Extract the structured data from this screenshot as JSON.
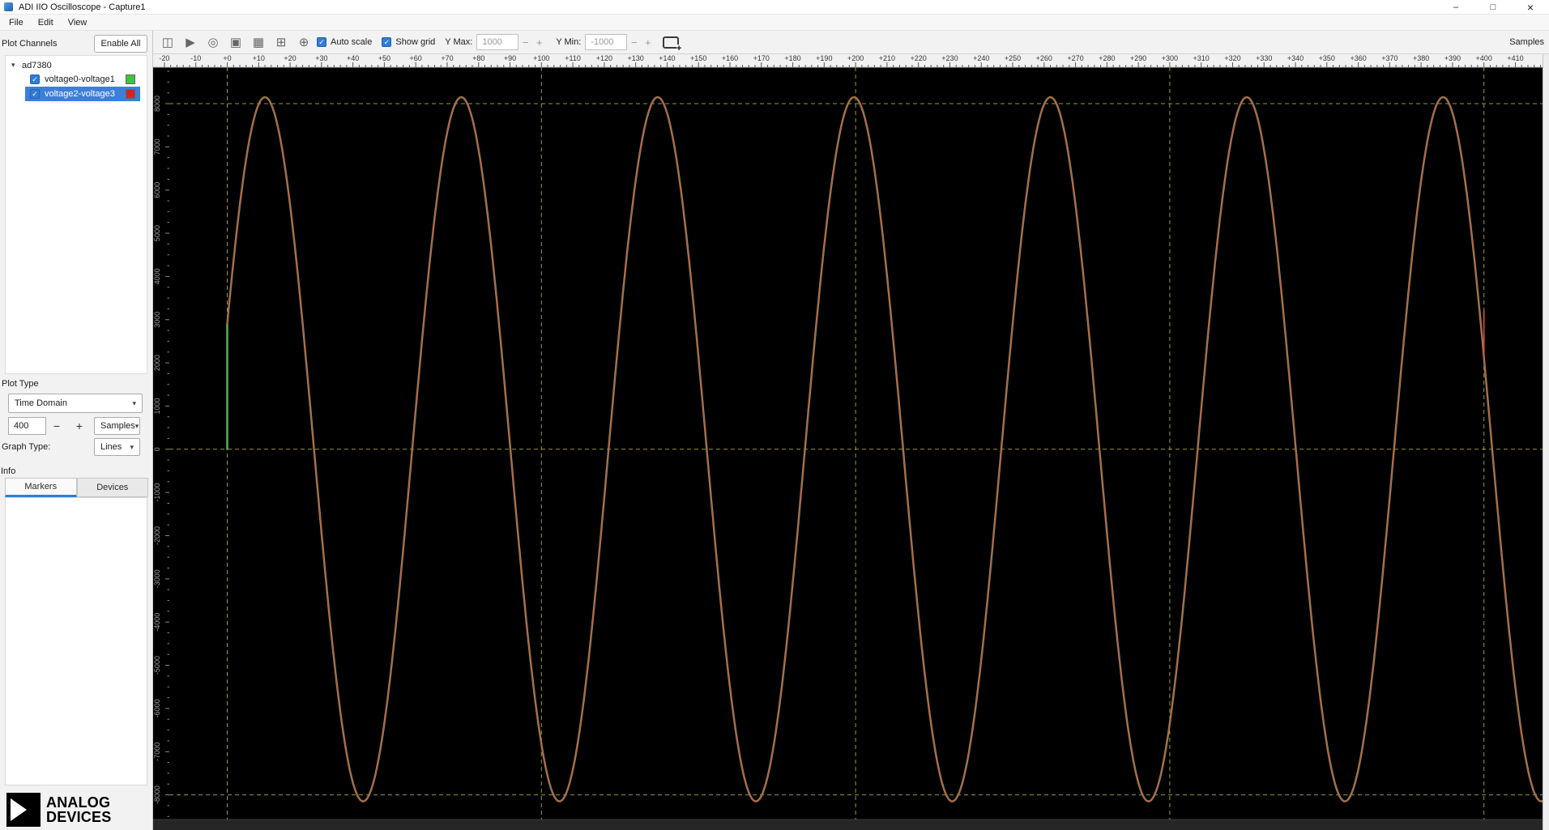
{
  "window": {
    "title": "ADI IIO Oscilloscope - Capture1",
    "controls": {
      "minimize": "–",
      "maximize": "□",
      "close": "×"
    }
  },
  "menu": {
    "items": [
      "File",
      "Edit",
      "View"
    ]
  },
  "toolbar": {
    "icons": [
      {
        "name": "capture-windows-icon",
        "glyph": "◫"
      },
      {
        "name": "play-icon",
        "glyph": "▶"
      },
      {
        "name": "capture-loop-icon",
        "glyph": "◎"
      },
      {
        "name": "snapshot-icon",
        "glyph": "▣"
      },
      {
        "name": "grid-view-icon",
        "glyph": "▦"
      },
      {
        "name": "add-grid-icon",
        "glyph": "⊞"
      },
      {
        "name": "pan-tool-icon",
        "glyph": "⊕"
      }
    ],
    "check_glyph": "✓",
    "autoscale_label": "Auto scale",
    "showgrid_label": "Show grid",
    "ymax_label": "Y Max:",
    "ymax_value": "1000",
    "ymin_label": "Y Min:",
    "ymin_value": "-1000",
    "minus_glyph": "−",
    "plus_glyph": "+",
    "samples_axis_label": "Samples"
  },
  "sidebar": {
    "plot_channels_label": "Plot Channels",
    "enable_all_label": "Enable All",
    "device_group": {
      "expander": "▾",
      "label": "ad7380"
    },
    "channels": [
      {
        "label": "voltage0-voltage1",
        "check": "✓",
        "swatch_style": "background:#3fc43f",
        "selected": false
      },
      {
        "label": "voltage2-voltage3",
        "check": "✓",
        "swatch_style": "background:#d42222",
        "selected": true
      }
    ],
    "plot_type_label": "Plot Type",
    "plot_type_value": "Time Domain",
    "dropdown_chevron": "▾",
    "sample_count_value": "400",
    "sample_minus": "−",
    "sample_plus": "+",
    "sample_unit_value": "Samples",
    "graph_type_label": "Graph Type:",
    "graph_type_value": "Lines",
    "info_label": "Info",
    "tabs": [
      {
        "label": "Markers",
        "active": true
      },
      {
        "label": "Devices",
        "active": false
      }
    ],
    "logo": {
      "line1": "ANALOG",
      "line2": "DEVICES"
    }
  },
  "chart_data": {
    "type": "line",
    "title": "",
    "xlabel": "Samples",
    "ylabel": "",
    "x_range": [
      -20,
      418.5
    ],
    "x_label_step": 10,
    "x_minor_step": 2,
    "x_grid_lines": [
      0,
      100,
      200,
      300,
      400
    ],
    "y_labels": [
      8000,
      7000,
      6000,
      5000,
      4000,
      3000,
      2000,
      1000,
      0,
      -1000,
      -2000,
      -3000,
      -4000,
      -5000,
      -6000,
      -7000,
      -8000
    ],
    "y_grid_lines": [
      8000,
      0,
      -8000
    ],
    "y_minor_tick_step": 250,
    "grid_on": true,
    "grid_color": "#aaaa3a",
    "plot_bg": "#000000",
    "series": [
      {
        "name": "voltage0-voltage1",
        "color": "#55b855",
        "width": 2.4,
        "waveform": "sine",
        "amplitude": 8150,
        "period_samples": 62.5,
        "peak_sample": 12,
        "start_sample": 0,
        "end_sample": 418.5,
        "start_spike_from_zero": true
      },
      {
        "name": "voltage2-voltage3",
        "color": "#e04848",
        "width": 1.4,
        "waveform": "sine",
        "amplitude": 8150,
        "period_samples": 62.5,
        "peak_sample": 12,
        "start_sample": 0,
        "end_sample": 418.5,
        "end_spike_sample": 400
      }
    ]
  }
}
